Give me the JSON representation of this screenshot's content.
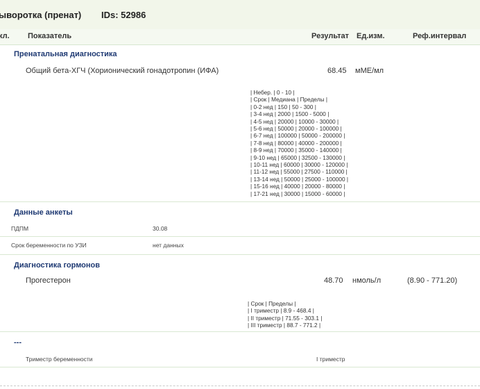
{
  "header": {
    "title": "ыворотка (пренат)",
    "ids": "IDs: 52986"
  },
  "columns": {
    "col1": "кл.",
    "indicator": "Показатель",
    "result": "Результат",
    "unit": "Ед.изм.",
    "ref": "Реф.интервал"
  },
  "sections": [
    {
      "title": "Пренатальная диагностика",
      "rows": [
        {
          "name": "Общий бета-ХГЧ (Хорионический гонадотропин (ИФА)",
          "result": "68.45",
          "unit": "мМЕ/мл",
          "ref": "",
          "note": "| Небер. | 0 - 10 |\n| Срок | Медиана | Пределы |\n| 0-2 нед | 150 | 50 - 300 |\n| 3-4 нед | 2000 | 1500 - 5000 |\n| 4-5 нед | 20000 | 10000 - 30000 |\n| 5-6 нед | 50000 | 20000 - 100000 |\n| 6-7 нед | 100000 | 50000 - 200000 |\n| 7-8 нед | 80000 | 40000 - 200000 |\n| 8-9 нед | 70000 | 35000 - 140000 |\n| 9-10 нед | 65000 | 32500 - 130000 |\n| 10-11 нед | 60000 | 30000 - 120000 |\n| 11-12 нед | 55000 | 27500 - 110000 |\n| 13-14 нед | 50000 | 25000 - 100000 |\n| 15-16 нед | 40000 | 20000 - 80000 |\n| 17-21 нед | 30000 | 15000 - 60000 |"
        }
      ]
    },
    {
      "title": "Данные анкеты",
      "rows": [
        {
          "name": "ПДПМ",
          "value": "30.08"
        },
        {
          "name": "Срок беременности по УЗИ",
          "value": "нет данных"
        }
      ]
    },
    {
      "title": "Диагностика гормонов",
      "rows": [
        {
          "name": "Прогестерон",
          "result": "48.70",
          "unit": "нмоль/л",
          "ref": "(8.90 - 771.20)",
          "note": "| Срок | Пределы |\n| I триместр | 8.9 - 468.4 |\n| II триместр | 71.55 - 303.1 |\n| III триместр | 88.7 - 771.2 |"
        }
      ]
    },
    {
      "title": "---",
      "rows": [
        {
          "name": "Триместр беременности",
          "value": "I триместр"
        }
      ]
    }
  ]
}
